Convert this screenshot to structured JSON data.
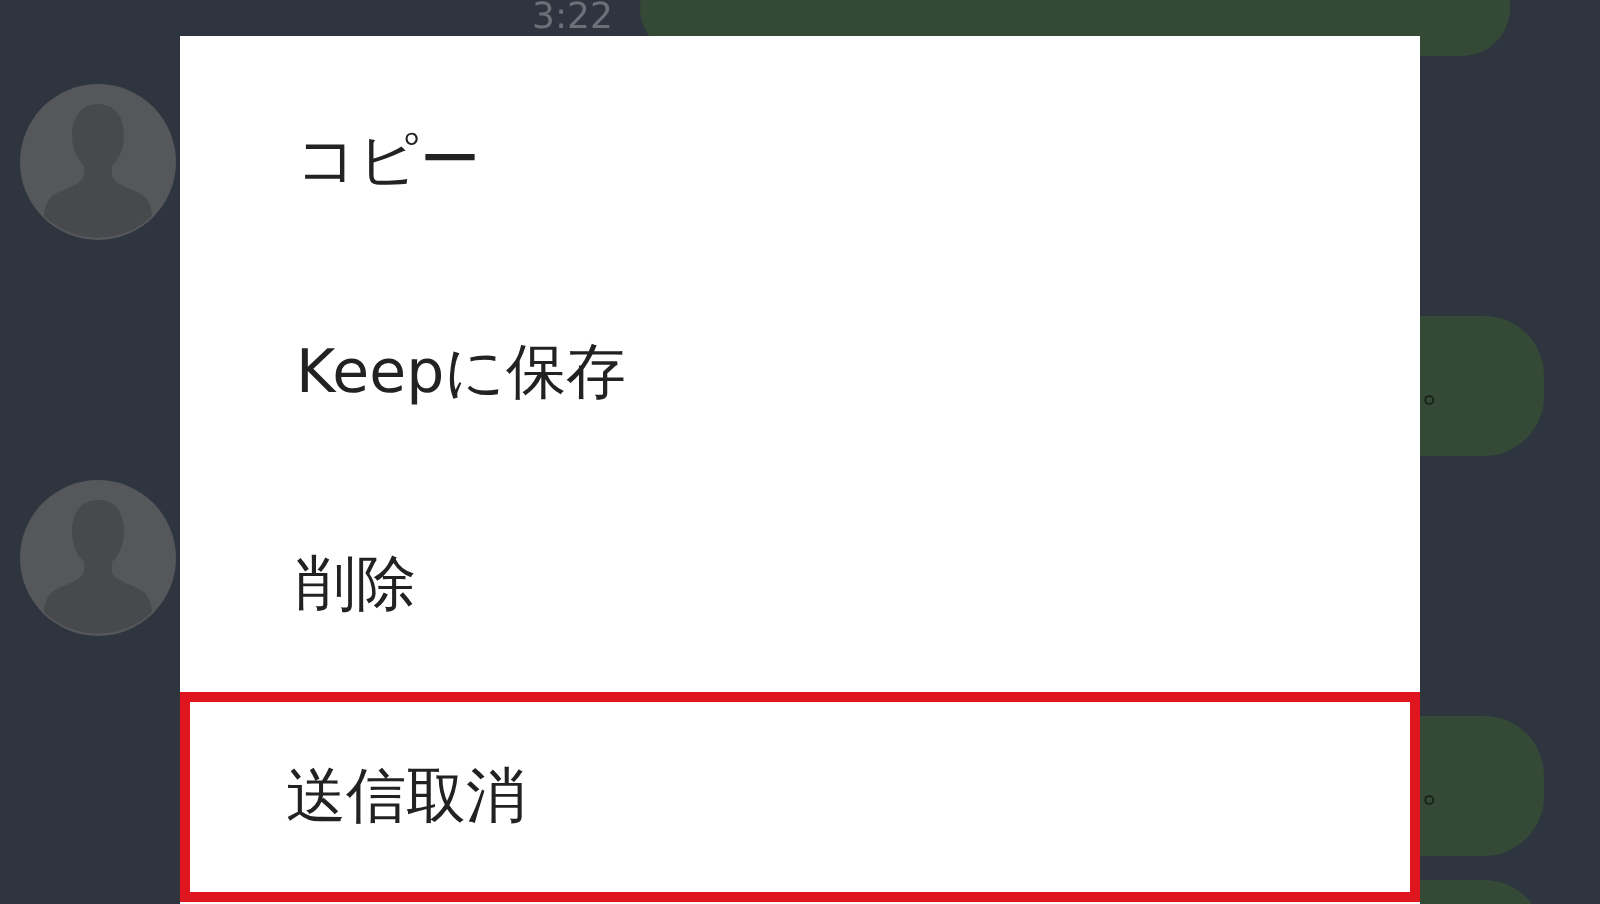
{
  "chat": {
    "time": "3:22",
    "messages": [
      {
        "text": "。"
      },
      {
        "text": "。"
      }
    ]
  },
  "menu": {
    "items": [
      {
        "label": "コピー",
        "highlighted": false
      },
      {
        "label": "Keepに保存",
        "highlighted": false
      },
      {
        "label": "削除",
        "highlighted": false
      },
      {
        "label": "送信取消",
        "highlighted": true
      }
    ]
  }
}
